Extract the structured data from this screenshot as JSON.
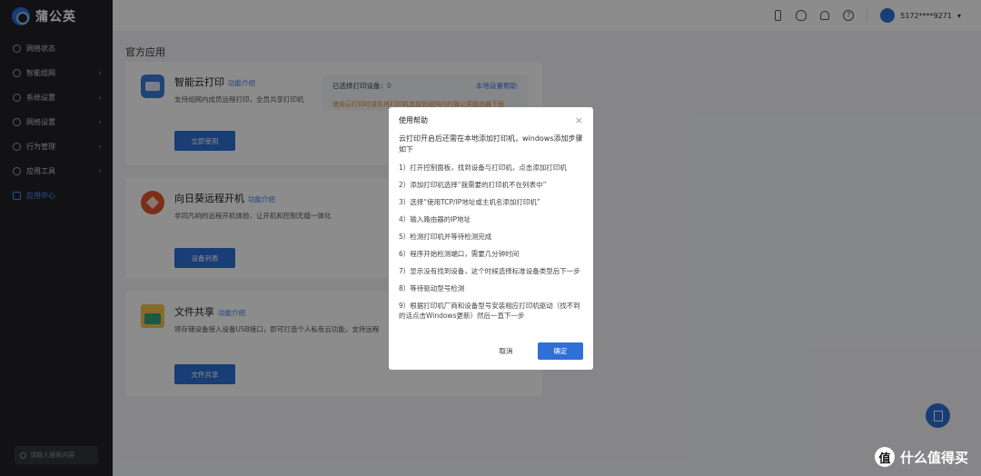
{
  "sidebar": {
    "logo_text": "蒲公英",
    "items": [
      {
        "label": "网络状态",
        "chevron": ""
      },
      {
        "label": "智能组网",
        "chevron": "›"
      },
      {
        "label": "系统设置",
        "chevron": "›"
      },
      {
        "label": "网络设置",
        "chevron": "›"
      },
      {
        "label": "行为管理",
        "chevron": "›"
      },
      {
        "label": "应用工具",
        "chevron": "›"
      },
      {
        "label": "应用中心",
        "chevron": ""
      }
    ],
    "active_index": 6,
    "search_placeholder": "请输入搜索内容"
  },
  "topbar": {
    "user_name": "5172****9271",
    "user_caret": "▾",
    "help_glyph": "?"
  },
  "main": {
    "section_title": "官方应用",
    "cards": [
      {
        "title": "智能云打印",
        "link": "功能介绍",
        "desc": "支持组网内成员远程打印，全员共享打印机",
        "button": "立即使用"
      },
      {
        "title": "向日葵远程开机",
        "link": "功能介绍",
        "desc": "非同凡响的远程开机体验，让开机和控制无缝一体化",
        "button": "设备列表"
      },
      {
        "title": "文件共享",
        "link": "功能介绍",
        "desc": "将存储设备接入设备USB接口，即可打造个人私有云功能，支持远程",
        "button": "文件共享"
      }
    ],
    "printer_status": {
      "label": "已选择打印设备：",
      "count": "0",
      "help_link": "本地设置帮助",
      "warning": "使用云打印时请先将打印机连接到组网内的蒲公英路由器下面"
    }
  },
  "modal": {
    "title": "使用帮助",
    "close": "×",
    "intro": "云打印开启后还需在本地添加打印机，windows添加步骤如下",
    "steps": [
      "1）打开控制面板，找到设备与打印机，点击添加打印机",
      "2）添加打印机选择“我需要的打印机不在列表中”",
      "3）选择“使用TCP/IP地址或主机名添加打印机”",
      "4）输入路由器的IP地址",
      "5）检测打印机并等待检测完成",
      "6）程序开始检测端口，需要几分钟时间",
      "7）显示没有找到设备，这个时候选择标准设备类型后下一步",
      "8）等待驱动型号检测",
      "9）根据打印机厂商和设备型号安装相应打印机驱动（找不到的话点击Windows更新）然后一直下一步"
    ],
    "cancel": "取消",
    "ok": "确定"
  },
  "watermark": {
    "badge": "值",
    "text": "什么值得买"
  },
  "colors": {
    "primary": "#2f6fd6",
    "sidebar_bg": "#212225",
    "warning": "#e08a2a",
    "link": "#3577e5"
  }
}
